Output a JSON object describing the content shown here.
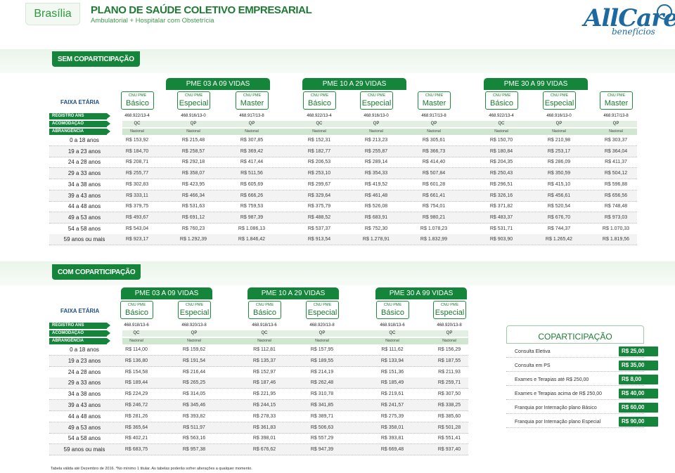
{
  "header": {
    "city": "Brasília",
    "title": "PLANO DE SAÚDE COLETIVO EMPRESARIAL",
    "subtitle": "Ambulatorial + Hospitalar com Obstetrícia",
    "logo_main": "AllCare",
    "logo_sub": "benefícios"
  },
  "labels": {
    "faixa": "FAIXA ETÁRIA",
    "registro": "REGISTRO ANS",
    "acomodacao": "ACOMODAÇÃO",
    "abrangencia": "ABRANGÊNCIA",
    "plan_kicker": "CNU PME"
  },
  "sem": {
    "badge": "SEM COPARTICIPAÇÃO",
    "groups": [
      "PME 03 A 09 VIDAS",
      "PME 10 A 29 VIDAS",
      "PME 30 A 99 VIDAS"
    ],
    "plans": [
      "Básico",
      "Especial",
      "Master",
      "Básico",
      "Especial",
      "Master",
      "Básico",
      "Especial",
      "Master"
    ],
    "registro": [
      "468.922/13-4",
      "468.916/13-0",
      "468.917/13-8",
      "468.922/13-4",
      "468.916/13-0",
      "468.917/13-8",
      "468.922/13-4",
      "468.916/13-0",
      "468.917/13-8"
    ],
    "acomodacao": [
      "QC",
      "QP",
      "QP",
      "QC",
      "QP",
      "QP",
      "QC",
      "QP",
      "QP"
    ],
    "abrangencia": [
      "Nacional",
      "Nacional",
      "Nacional",
      "Nacional",
      "Nacional",
      "Nacional",
      "Nacional",
      "Nacional",
      "Nacional"
    ],
    "rows": [
      {
        "age": "0 a 18 anos",
        "values": [
          "R$ 153,92",
          "R$ 215,48",
          "R$ 307,85",
          "R$ 152,31",
          "R$ 213,23",
          "R$ 305,61",
          "R$ 150,70",
          "R$ 210,98",
          "R$ 303,37"
        ]
      },
      {
        "age": "19 a 23 anos",
        "values": [
          "R$ 184,70",
          "R$ 258,57",
          "R$ 369,42",
          "R$ 182,77",
          "R$ 255,87",
          "R$ 366,73",
          "R$ 180,84",
          "R$ 253,17",
          "R$ 364,04"
        ]
      },
      {
        "age": "24 a 28 anos",
        "values": [
          "R$ 208,71",
          "R$ 292,18",
          "R$ 417,44",
          "R$ 206,53",
          "R$ 289,14",
          "R$ 414,40",
          "R$ 204,35",
          "R$ 286,09",
          "R$ 411,37"
        ]
      },
      {
        "age": "29 a 33 anos",
        "values": [
          "R$ 255,77",
          "R$ 358,07",
          "R$ 511,56",
          "R$ 253,10",
          "R$ 354,33",
          "R$ 507,84",
          "R$ 250,43",
          "R$ 350,59",
          "R$ 504,12"
        ]
      },
      {
        "age": "34 a 38 anos",
        "values": [
          "R$ 302,83",
          "R$ 423,95",
          "R$ 605,69",
          "R$ 299,67",
          "R$ 419,52",
          "R$ 601,28",
          "R$ 296,51",
          "R$ 415,10",
          "R$ 596,88"
        ]
      },
      {
        "age": "39 a 43 anos",
        "values": [
          "R$ 333,11",
          "R$ 466,34",
          "R$ 666,26",
          "R$ 329,64",
          "R$ 461,48",
          "R$ 661,41",
          "R$ 326,16",
          "R$ 456,61",
          "R$ 656,56"
        ]
      },
      {
        "age": "44 a 48 anos",
        "values": [
          "R$ 379,75",
          "R$ 531,63",
          "R$ 759,53",
          "R$ 375,79",
          "R$ 526,08",
          "R$ 754,01",
          "R$ 371,82",
          "R$ 520,54",
          "R$ 748,48"
        ]
      },
      {
        "age": "49 a 53 anos",
        "values": [
          "R$ 493,67",
          "R$ 691,12",
          "R$ 987,39",
          "R$ 488,52",
          "R$ 683,91",
          "R$ 980,21",
          "R$ 483,37",
          "R$ 676,70",
          "R$ 973,03"
        ]
      },
      {
        "age": "54 a 58 anos",
        "values": [
          "R$ 543,04",
          "R$ 760,23",
          "R$ 1.086,13",
          "R$ 537,37",
          "R$ 752,30",
          "R$ 1.078,23",
          "R$ 531,71",
          "R$ 744,37",
          "R$ 1.070,33"
        ]
      },
      {
        "age": "59 anos ou mais",
        "values": [
          "R$ 923,17",
          "R$ 1.292,39",
          "R$ 1.846,42",
          "R$ 913,54",
          "R$ 1.278,91",
          "R$ 1.832,99",
          "R$ 903,90",
          "R$ 1.265,42",
          "R$ 1.819,56"
        ]
      }
    ]
  },
  "com": {
    "badge": "COM COPARTICIPAÇÃO",
    "groups": [
      "PME 03 A 09 VIDAS",
      "PME 10 A 29 VIDAS",
      "PME 30 A 99 VIDAS"
    ],
    "plans": [
      "Básico",
      "Especial",
      "Básico",
      "Especial",
      "Básico",
      "Especial"
    ],
    "registro": [
      "468.918/13-6",
      "468.920/13-8",
      "468.918/13-6",
      "468.920/13-8",
      "468.918/13-6",
      "468.920/13-8"
    ],
    "acomodacao": [
      "QC",
      "QP",
      "QC",
      "QP",
      "QC",
      "QP"
    ],
    "abrangencia": [
      "Nacional",
      "Nacional",
      "Nacional",
      "Nacional",
      "Nacional",
      "Nacional"
    ],
    "rows": [
      {
        "age": "0 a 18 anos",
        "values": [
          "R$ 114,00",
          "R$ 159,62",
          "R$ 112,81",
          "R$ 157,95",
          "R$ 111,62",
          "R$ 156,29"
        ]
      },
      {
        "age": "19 a 23 anos",
        "values": [
          "R$ 136,80",
          "R$ 191,54",
          "R$ 135,37",
          "R$ 189,55",
          "R$ 133,94",
          "R$ 187,55"
        ]
      },
      {
        "age": "24 a 28 anos",
        "values": [
          "R$ 154,58",
          "R$ 216,44",
          "R$ 152,97",
          "R$ 214,19",
          "R$ 151,36",
          "R$ 211,93"
        ]
      },
      {
        "age": "29 a 33 anos",
        "values": [
          "R$ 189,44",
          "R$ 265,25",
          "R$ 187,46",
          "R$ 262,48",
          "R$ 185,49",
          "R$ 259,71"
        ]
      },
      {
        "age": "34 a 38 anos",
        "values": [
          "R$ 224,29",
          "R$ 314,05",
          "R$ 221,95",
          "R$ 310,78",
          "R$ 219,61",
          "R$ 307,50"
        ]
      },
      {
        "age": "39 a 43 anos",
        "values": [
          "R$ 246,72",
          "R$ 345,46",
          "R$ 244,15",
          "R$ 341,85",
          "R$ 241,57",
          "R$ 338,25"
        ]
      },
      {
        "age": "44 a 48 anos",
        "values": [
          "R$ 281,26",
          "R$ 393,82",
          "R$ 278,33",
          "R$ 389,71",
          "R$ 275,39",
          "R$ 385,60"
        ]
      },
      {
        "age": "49 a 53 anos",
        "values": [
          "R$ 365,64",
          "R$ 511,97",
          "R$ 361,83",
          "R$ 506,63",
          "R$ 358,01",
          "R$ 501,28"
        ]
      },
      {
        "age": "54 a 58 anos",
        "values": [
          "R$ 402,21",
          "R$ 563,16",
          "R$ 398,01",
          "R$ 557,29",
          "R$ 393,81",
          "R$ 551,41"
        ]
      },
      {
        "age": "59 anos ou mais",
        "values": [
          "R$ 683,75",
          "R$ 957,38",
          "R$ 676,62",
          "R$ 947,39",
          "R$ 669,48",
          "R$ 937,40"
        ]
      }
    ]
  },
  "copart": {
    "title": "COPARTICIPAÇÃO",
    "items": [
      {
        "label": "Consulta Eletiva",
        "price": "R$ 25,00"
      },
      {
        "label": "Consulta em PS",
        "price": "R$ 35,00"
      },
      {
        "label": "Exames e Terapias até R$ 250,00",
        "price": "R$ 8,00"
      },
      {
        "label": "Exames e Terapias acima de R$ 250,00",
        "price": "R$ 40,00"
      },
      {
        "label": "Franquia por Internação plano Básico",
        "price": "R$ 60,00"
      },
      {
        "label": "Franquia por Internação plano Especial",
        "price": "R$ 90,00"
      }
    ]
  },
  "footnote": "Tabela válida até Dezembro de 2016. *No mínimo 1 titular. As tabelas poderão sofrer alterações a qualquer momento.",
  "colors": {
    "green": "#14853a",
    "blue_title": "#1f4f8a",
    "logo_blue": "#1c6aa0"
  }
}
